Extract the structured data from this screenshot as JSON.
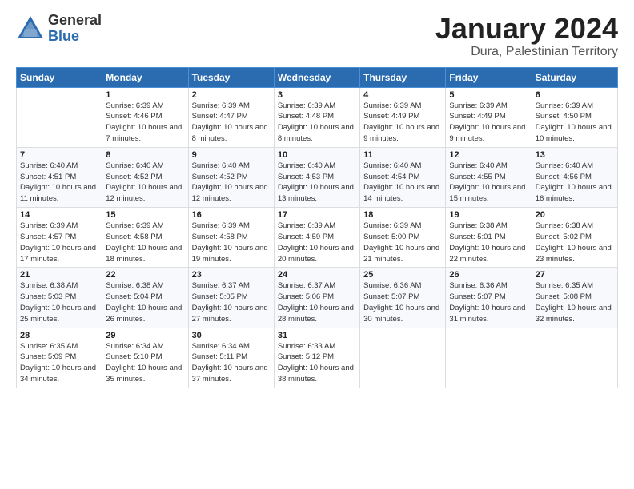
{
  "header": {
    "logo_general": "General",
    "logo_blue": "Blue",
    "month_title": "January 2024",
    "location": "Dura, Palestinian Territory"
  },
  "days_of_week": [
    "Sunday",
    "Monday",
    "Tuesday",
    "Wednesday",
    "Thursday",
    "Friday",
    "Saturday"
  ],
  "weeks": [
    [
      {
        "day": "",
        "sunrise": "",
        "sunset": "",
        "daylight": ""
      },
      {
        "day": "1",
        "sunrise": "Sunrise: 6:39 AM",
        "sunset": "Sunset: 4:46 PM",
        "daylight": "Daylight: 10 hours and 7 minutes."
      },
      {
        "day": "2",
        "sunrise": "Sunrise: 6:39 AM",
        "sunset": "Sunset: 4:47 PM",
        "daylight": "Daylight: 10 hours and 8 minutes."
      },
      {
        "day": "3",
        "sunrise": "Sunrise: 6:39 AM",
        "sunset": "Sunset: 4:48 PM",
        "daylight": "Daylight: 10 hours and 8 minutes."
      },
      {
        "day": "4",
        "sunrise": "Sunrise: 6:39 AM",
        "sunset": "Sunset: 4:49 PM",
        "daylight": "Daylight: 10 hours and 9 minutes."
      },
      {
        "day": "5",
        "sunrise": "Sunrise: 6:39 AM",
        "sunset": "Sunset: 4:49 PM",
        "daylight": "Daylight: 10 hours and 9 minutes."
      },
      {
        "day": "6",
        "sunrise": "Sunrise: 6:39 AM",
        "sunset": "Sunset: 4:50 PM",
        "daylight": "Daylight: 10 hours and 10 minutes."
      }
    ],
    [
      {
        "day": "7",
        "sunrise": "Sunrise: 6:40 AM",
        "sunset": "Sunset: 4:51 PM",
        "daylight": "Daylight: 10 hours and 11 minutes."
      },
      {
        "day": "8",
        "sunrise": "Sunrise: 6:40 AM",
        "sunset": "Sunset: 4:52 PM",
        "daylight": "Daylight: 10 hours and 12 minutes."
      },
      {
        "day": "9",
        "sunrise": "Sunrise: 6:40 AM",
        "sunset": "Sunset: 4:52 PM",
        "daylight": "Daylight: 10 hours and 12 minutes."
      },
      {
        "day": "10",
        "sunrise": "Sunrise: 6:40 AM",
        "sunset": "Sunset: 4:53 PM",
        "daylight": "Daylight: 10 hours and 13 minutes."
      },
      {
        "day": "11",
        "sunrise": "Sunrise: 6:40 AM",
        "sunset": "Sunset: 4:54 PM",
        "daylight": "Daylight: 10 hours and 14 minutes."
      },
      {
        "day": "12",
        "sunrise": "Sunrise: 6:40 AM",
        "sunset": "Sunset: 4:55 PM",
        "daylight": "Daylight: 10 hours and 15 minutes."
      },
      {
        "day": "13",
        "sunrise": "Sunrise: 6:40 AM",
        "sunset": "Sunset: 4:56 PM",
        "daylight": "Daylight: 10 hours and 16 minutes."
      }
    ],
    [
      {
        "day": "14",
        "sunrise": "Sunrise: 6:39 AM",
        "sunset": "Sunset: 4:57 PM",
        "daylight": "Daylight: 10 hours and 17 minutes."
      },
      {
        "day": "15",
        "sunrise": "Sunrise: 6:39 AM",
        "sunset": "Sunset: 4:58 PM",
        "daylight": "Daylight: 10 hours and 18 minutes."
      },
      {
        "day": "16",
        "sunrise": "Sunrise: 6:39 AM",
        "sunset": "Sunset: 4:58 PM",
        "daylight": "Daylight: 10 hours and 19 minutes."
      },
      {
        "day": "17",
        "sunrise": "Sunrise: 6:39 AM",
        "sunset": "Sunset: 4:59 PM",
        "daylight": "Daylight: 10 hours and 20 minutes."
      },
      {
        "day": "18",
        "sunrise": "Sunrise: 6:39 AM",
        "sunset": "Sunset: 5:00 PM",
        "daylight": "Daylight: 10 hours and 21 minutes."
      },
      {
        "day": "19",
        "sunrise": "Sunrise: 6:38 AM",
        "sunset": "Sunset: 5:01 PM",
        "daylight": "Daylight: 10 hours and 22 minutes."
      },
      {
        "day": "20",
        "sunrise": "Sunrise: 6:38 AM",
        "sunset": "Sunset: 5:02 PM",
        "daylight": "Daylight: 10 hours and 23 minutes."
      }
    ],
    [
      {
        "day": "21",
        "sunrise": "Sunrise: 6:38 AM",
        "sunset": "Sunset: 5:03 PM",
        "daylight": "Daylight: 10 hours and 25 minutes."
      },
      {
        "day": "22",
        "sunrise": "Sunrise: 6:38 AM",
        "sunset": "Sunset: 5:04 PM",
        "daylight": "Daylight: 10 hours and 26 minutes."
      },
      {
        "day": "23",
        "sunrise": "Sunrise: 6:37 AM",
        "sunset": "Sunset: 5:05 PM",
        "daylight": "Daylight: 10 hours and 27 minutes."
      },
      {
        "day": "24",
        "sunrise": "Sunrise: 6:37 AM",
        "sunset": "Sunset: 5:06 PM",
        "daylight": "Daylight: 10 hours and 28 minutes."
      },
      {
        "day": "25",
        "sunrise": "Sunrise: 6:36 AM",
        "sunset": "Sunset: 5:07 PM",
        "daylight": "Daylight: 10 hours and 30 minutes."
      },
      {
        "day": "26",
        "sunrise": "Sunrise: 6:36 AM",
        "sunset": "Sunset: 5:07 PM",
        "daylight": "Daylight: 10 hours and 31 minutes."
      },
      {
        "day": "27",
        "sunrise": "Sunrise: 6:35 AM",
        "sunset": "Sunset: 5:08 PM",
        "daylight": "Daylight: 10 hours and 32 minutes."
      }
    ],
    [
      {
        "day": "28",
        "sunrise": "Sunrise: 6:35 AM",
        "sunset": "Sunset: 5:09 PM",
        "daylight": "Daylight: 10 hours and 34 minutes."
      },
      {
        "day": "29",
        "sunrise": "Sunrise: 6:34 AM",
        "sunset": "Sunset: 5:10 PM",
        "daylight": "Daylight: 10 hours and 35 minutes."
      },
      {
        "day": "30",
        "sunrise": "Sunrise: 6:34 AM",
        "sunset": "Sunset: 5:11 PM",
        "daylight": "Daylight: 10 hours and 37 minutes."
      },
      {
        "day": "31",
        "sunrise": "Sunrise: 6:33 AM",
        "sunset": "Sunset: 5:12 PM",
        "daylight": "Daylight: 10 hours and 38 minutes."
      },
      {
        "day": "",
        "sunrise": "",
        "sunset": "",
        "daylight": ""
      },
      {
        "day": "",
        "sunrise": "",
        "sunset": "",
        "daylight": ""
      },
      {
        "day": "",
        "sunrise": "",
        "sunset": "",
        "daylight": ""
      }
    ]
  ]
}
